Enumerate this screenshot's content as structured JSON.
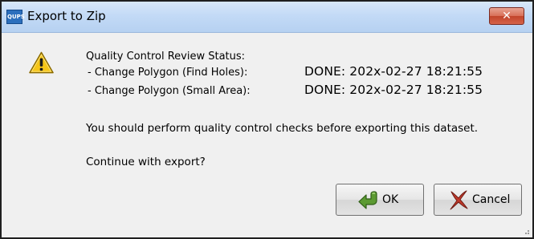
{
  "window": {
    "app_icon_text": "QUPS",
    "title": "Export to Zip",
    "close_glyph": "✕"
  },
  "icons": {
    "app": "app-icon",
    "warning": "warning-icon",
    "ok": "green-arrow-icon",
    "cancel": "red-x-icon",
    "close": "close-icon"
  },
  "status": {
    "heading": "Quality Control Review Status:",
    "rows": [
      {
        "label": "- Change Polygon (Find Holes):",
        "value": "DONE: 202x-02-27 18:21:55"
      },
      {
        "label": "- Change Polygon (Small Area):",
        "value": "DONE: 202x-02-27 18:21:55"
      }
    ]
  },
  "message": "You should perform quality control checks before exporting this dataset.",
  "question": "Continue with export?",
  "buttons": {
    "ok_label": "OK",
    "cancel_label": "Cancel"
  },
  "colors": {
    "titlebar": "#c3daf6",
    "close_button": "#c9472c",
    "dialog_background": "#f0f0f0",
    "warning_fill": "#f5c518",
    "ok_arrow": "#4f8a2b",
    "cancel_x": "#c0392b"
  }
}
